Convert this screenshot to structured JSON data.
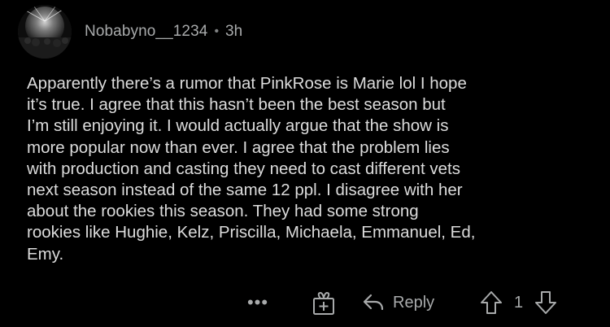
{
  "comment": {
    "username": "Nobabyno__1234",
    "separator": "•",
    "time": "3h",
    "body": "Apparently there’s a rumor that PinkRose is Marie lol I hope\nit’s true. I agree that this hasn’t been the best season but\nI’m still enjoying it. I would actually argue that the show is\nmore popular now than ever. I agree that the problem lies\nwith production and casting they need to cast different vets\nnext season instead of the same 12 ppl. I disagree with her\nabout the rookies this season. They had some strong\nrookies like Hughie, Kelz, Priscilla, Michaela, Emmanuel, Ed,\nEmy.",
    "actions": {
      "more_label": "•••",
      "reply_label": "Reply",
      "vote_count": "1"
    }
  },
  "colors": {
    "background": "#000000",
    "text": "#dcdcdc",
    "muted": "#a8aaab"
  },
  "icons": {
    "more": "more-dots-icon",
    "award": "award-gift-icon",
    "reply": "reply-arrow-icon",
    "upvote": "upvote-arrow-icon",
    "downvote": "downvote-arrow-icon"
  }
}
